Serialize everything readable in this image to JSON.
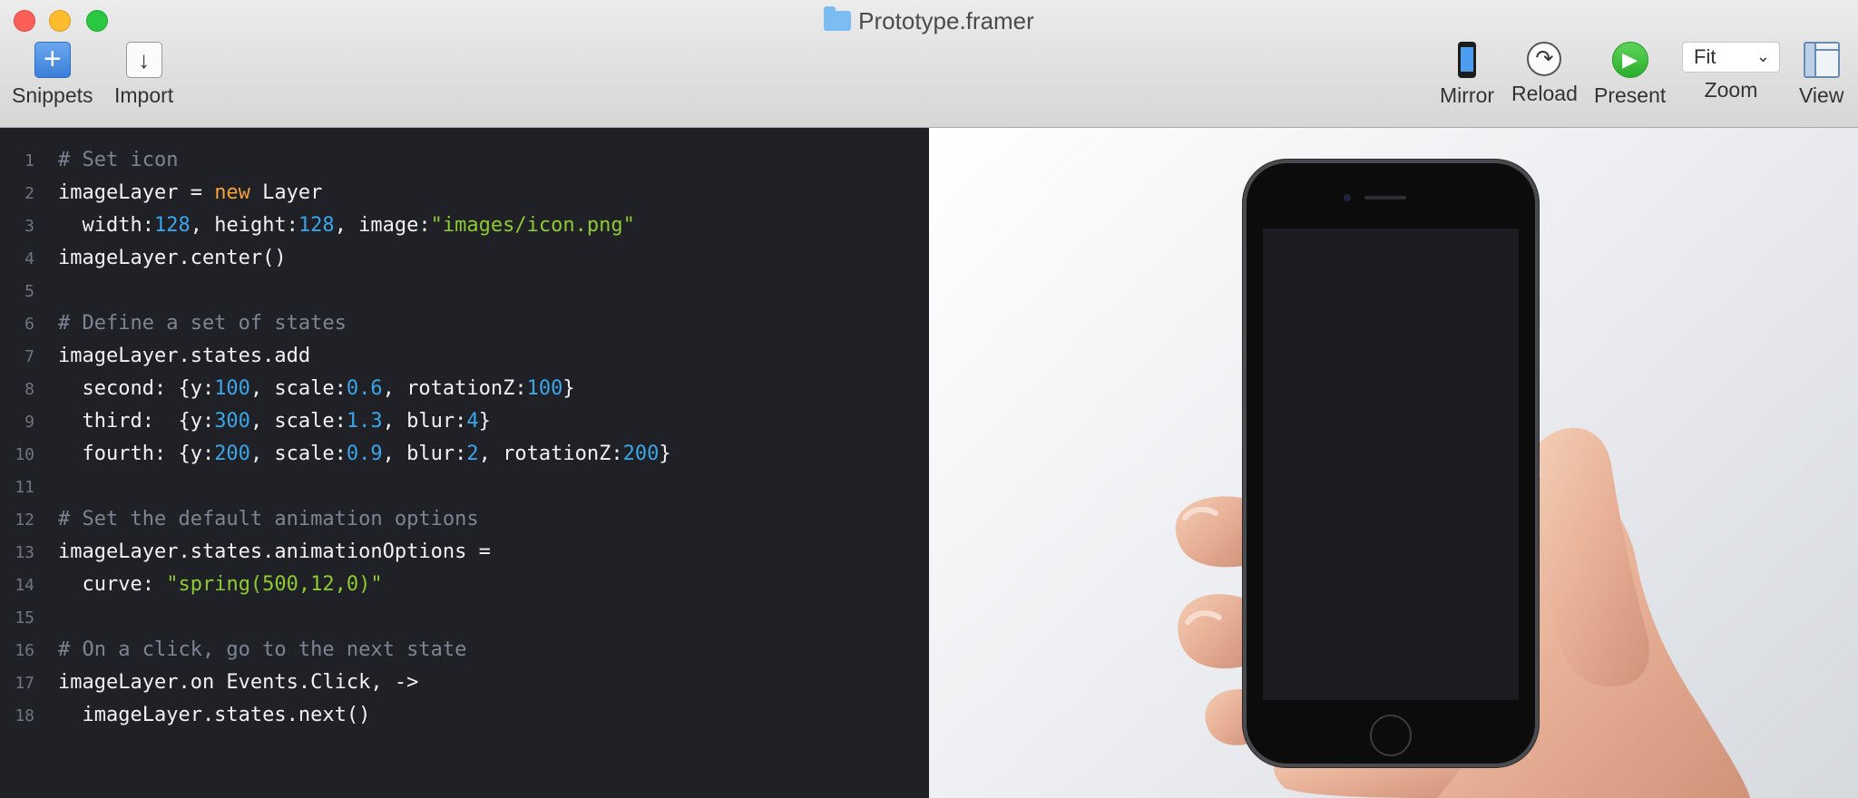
{
  "window": {
    "title": "Prototype.framer"
  },
  "toolbar": {
    "snippets": "Snippets",
    "import": "Import",
    "mirror": "Mirror",
    "reload": "Reload",
    "present": "Present",
    "zoom_value": "Fit",
    "zoom": "Zoom",
    "view": "View"
  },
  "code": [
    {
      "n": "1",
      "t": [
        [
          "# Set icon",
          "comment"
        ]
      ]
    },
    {
      "n": "2",
      "t": [
        [
          "imageLayer = ",
          ""
        ],
        [
          "new",
          "keyword"
        ],
        [
          " Layer",
          ""
        ]
      ]
    },
    {
      "n": "3",
      "t": [
        [
          "  width:",
          ""
        ],
        [
          "128",
          "number"
        ],
        [
          ", height:",
          ""
        ],
        [
          "128",
          "number"
        ],
        [
          ", image:",
          ""
        ],
        [
          "\"images/icon.png\"",
          "string"
        ]
      ]
    },
    {
      "n": "4",
      "t": [
        [
          "imageLayer.center()",
          ""
        ]
      ]
    },
    {
      "n": "5",
      "t": []
    },
    {
      "n": "6",
      "t": [
        [
          "# Define a set of states",
          "comment"
        ]
      ]
    },
    {
      "n": "7",
      "t": [
        [
          "imageLayer.states.add",
          ""
        ]
      ]
    },
    {
      "n": "8",
      "t": [
        [
          "  second: {y:",
          ""
        ],
        [
          "100",
          "number"
        ],
        [
          ", scale:",
          ""
        ],
        [
          "0.6",
          "number"
        ],
        [
          ", rotationZ:",
          ""
        ],
        [
          "100",
          "number"
        ],
        [
          "}",
          ""
        ]
      ]
    },
    {
      "n": "9",
      "t": [
        [
          "  third:  {y:",
          ""
        ],
        [
          "300",
          "number"
        ],
        [
          ", scale:",
          ""
        ],
        [
          "1.3",
          "number"
        ],
        [
          ", blur:",
          ""
        ],
        [
          "4",
          "number"
        ],
        [
          "}",
          ""
        ]
      ]
    },
    {
      "n": "10",
      "t": [
        [
          "  fourth: {y:",
          ""
        ],
        [
          "200",
          "number"
        ],
        [
          ", scale:",
          ""
        ],
        [
          "0.9",
          "number"
        ],
        [
          ", blur:",
          ""
        ],
        [
          "2",
          "number"
        ],
        [
          ", rotationZ:",
          ""
        ],
        [
          "200",
          "number"
        ],
        [
          "}",
          ""
        ]
      ]
    },
    {
      "n": "11",
      "t": []
    },
    {
      "n": "12",
      "t": [
        [
          "# Set the default animation options",
          "comment"
        ]
      ]
    },
    {
      "n": "13",
      "t": [
        [
          "imageLayer.states.animationOptions =",
          ""
        ]
      ]
    },
    {
      "n": "14",
      "t": [
        [
          "  curve: ",
          ""
        ],
        [
          "\"spring(500,12,0)\"",
          "string"
        ]
      ]
    },
    {
      "n": "15",
      "t": []
    },
    {
      "n": "16",
      "t": [
        [
          "# On a click, go to the next state",
          "comment"
        ]
      ]
    },
    {
      "n": "17",
      "t": [
        [
          "imageLayer.on Events.Click, ->",
          ""
        ]
      ]
    },
    {
      "n": "18",
      "t": [
        [
          "  imageLayer.states.next()",
          ""
        ]
      ]
    }
  ],
  "colors": {
    "editor_bg": "#1f2126",
    "comment": "#7d8594",
    "keyword": "#f3a13b",
    "number": "#3aa6e9",
    "string": "#8ecb2f"
  },
  "icons": [
    "plus-icon",
    "import-arrow-icon",
    "phone-icon",
    "reload-icon",
    "play-icon",
    "chevron-down-icon",
    "sidebar-view-icon",
    "folder-icon"
  ]
}
